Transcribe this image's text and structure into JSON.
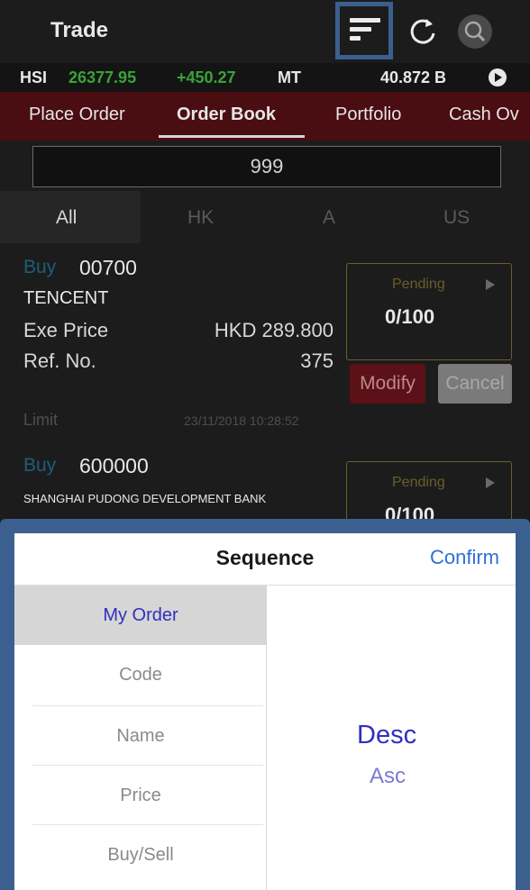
{
  "header": {
    "title": "Trade",
    "icons": [
      "sort-icon",
      "refresh-icon",
      "search-icon"
    ]
  },
  "ticker": {
    "index": "HSI",
    "value": "26377.95",
    "change": "+450.27",
    "mt_label": "MT",
    "volume": "40.872 B"
  },
  "tabs": [
    {
      "label": "Place Order"
    },
    {
      "label": "Order Book"
    },
    {
      "label": "Portfolio"
    },
    {
      "label": "Cash Ov"
    }
  ],
  "search": {
    "value": "999"
  },
  "markets": [
    {
      "label": "All"
    },
    {
      "label": "HK"
    },
    {
      "label": "A"
    },
    {
      "label": "US"
    }
  ],
  "orders": [
    {
      "side": "Buy",
      "code": "00700",
      "name": "TENCENT",
      "price_label": "Exe Price",
      "price": "HKD 289.800",
      "ref_label": "Ref. No.",
      "ref": "375",
      "type": "Limit",
      "time": "23/11/2018 10:28:52",
      "status": "Pending",
      "qty": "0/100",
      "modify": "Modify",
      "cancel": "Cancel"
    },
    {
      "side": "Buy",
      "code": "600000",
      "name": "SHANGHAI PUDONG DEVELOPMENT BANK",
      "status": "Pending",
      "qty": "0/100"
    }
  ],
  "sheet": {
    "title": "Sequence",
    "confirm": "Confirm",
    "options": [
      {
        "label": "My Order"
      },
      {
        "label": "Code"
      },
      {
        "label": "Name"
      },
      {
        "label": "Price"
      },
      {
        "label": "Buy/Sell"
      }
    ],
    "selected_option": "My Order",
    "directions": {
      "desc": "Desc",
      "asc": "Asc"
    },
    "selected_direction": "Desc"
  },
  "colors": {
    "tab_bar": "#4a0d12",
    "positive": "#3aa23a",
    "highlight_frame": "#3b5f8e",
    "selected_text": "#2f2fbe",
    "confirm": "#2f6fd6"
  }
}
